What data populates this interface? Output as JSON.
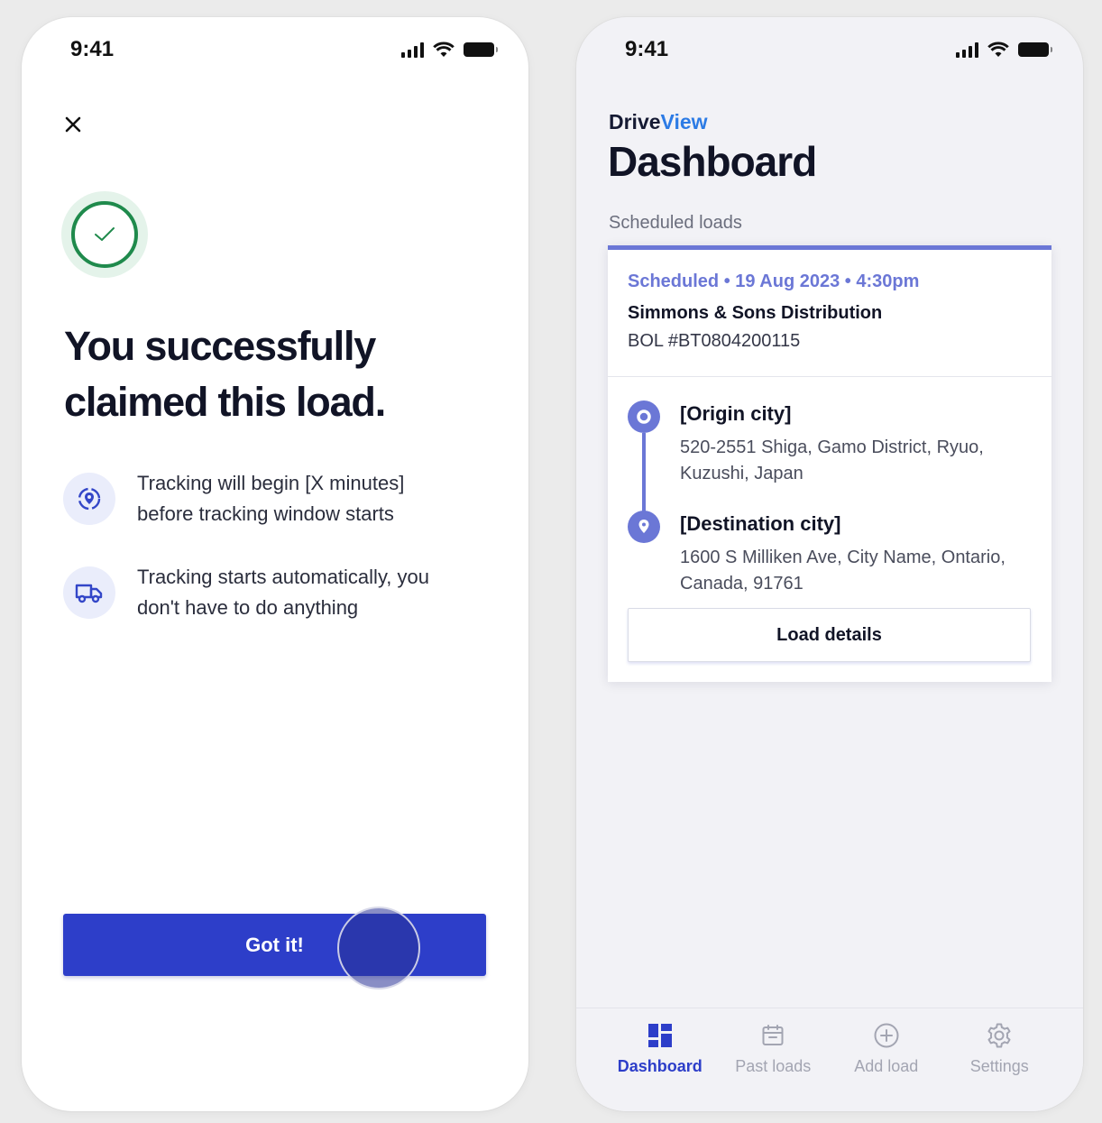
{
  "left_screen": {
    "status_bar": {
      "time": "9:41"
    },
    "headline": "You successfully claimed this load.",
    "info_items": [
      {
        "icon": "location-target-icon",
        "text": "Tracking will begin [X minutes]\nbefore tracking window starts"
      },
      {
        "icon": "truck-icon",
        "text": "Tracking starts automatically, you\ndon't have to do anything"
      }
    ],
    "primary_button": "Got it!"
  },
  "right_screen": {
    "status_bar": {
      "time": "9:41"
    },
    "brand": {
      "part1": "Drive",
      "part2": "View"
    },
    "title": "Dashboard",
    "section_label": "Scheduled loads",
    "load": {
      "status": "Scheduled • 19 Aug 2023 • 4:30pm",
      "company": "Simmons & Sons Distribution",
      "bol": "BOL #BT0804200115",
      "origin": {
        "city": "[Origin city]",
        "address": "520-2551 Shiga, Gamo District, Ryuo,\nKuzushi, Japan"
      },
      "destination": {
        "city": "[Destination city]",
        "address": "1600 S Milliken Ave, City Name, Ontario,\nCanada, 91761"
      },
      "details_button": "Load details"
    },
    "tabs": [
      {
        "label": "Dashboard",
        "icon": "dashboard-icon",
        "active": true
      },
      {
        "label": "Past loads",
        "icon": "calendar-icon",
        "active": false
      },
      {
        "label": "Add load",
        "icon": "add-circle-icon",
        "active": false
      },
      {
        "label": "Settings",
        "icon": "gear-icon",
        "active": false
      }
    ]
  },
  "colors": {
    "primary": "#2d3ec9",
    "accent": "#6b77d6",
    "brand_blue": "#2c7be5",
    "success": "#1f8a4c"
  }
}
